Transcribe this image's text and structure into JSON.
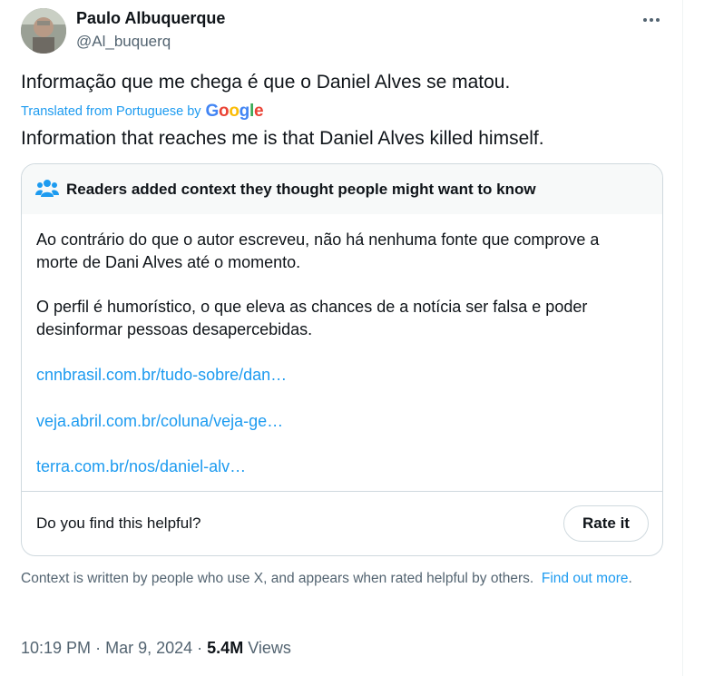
{
  "author": {
    "name": "Paulo Albuquerque",
    "handle": "@Al_buquerq"
  },
  "tweet": {
    "text": "Informação que me chega é que o Daniel Alves se matou.",
    "translated_label": "Translated from Portuguese by",
    "translator": "Google",
    "translation": "Information that reaches me is that Daniel Alves killed himself."
  },
  "note": {
    "header": "Readers added context they thought people might want to know",
    "paragraphs": [
      "Ao contrário do que o autor escreveu, não há nenhuma fonte que comprove a morte de Dani Alves até o momento.",
      "O perfil é humorístico, o que eleva as chances de a notícia ser falsa e poder desinformar pessoas desapercebidas."
    ],
    "links": [
      "cnnbrasil.com.br/tudo-sobre/dan…",
      "veja.abril.com.br/coluna/veja-ge…",
      "terra.com.br/nos/daniel-alv…"
    ],
    "helpful_question": "Do you find this helpful?",
    "rate_label": "Rate it"
  },
  "context_footer": {
    "text": "Context is written by people who use X, and appears when rated helpful by others.",
    "link": "Find out more",
    "suffix": "."
  },
  "meta": {
    "time": "10:19 PM",
    "date": "Mar 9, 2024",
    "views_count": "5.4M",
    "views_label": "Views",
    "separator": "·"
  },
  "colors": {
    "accent": "#1d9bf0",
    "secondary_text": "#536471",
    "border": "#cfd9de"
  },
  "icons": [
    "more-icon",
    "people-icon"
  ]
}
